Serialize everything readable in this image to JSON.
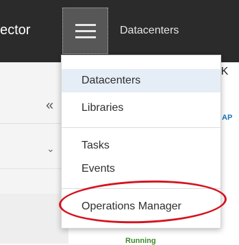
{
  "header": {
    "brand": "ector",
    "nav_label": "Datacenters"
  },
  "left_pane": {
    "collapse_glyph": "«",
    "expand_glyph": "⌄"
  },
  "background": {
    "title_fragment": ")-K",
    "link_fragment": "AP",
    "status": "Running"
  },
  "dropdown": {
    "items": [
      {
        "label": "Datacenters",
        "selected": true
      },
      {
        "label": "Libraries",
        "selected": false
      },
      {
        "label": "Tasks",
        "selected": false
      },
      {
        "label": "Events",
        "selected": false
      },
      {
        "label": "Operations Manager",
        "selected": false
      }
    ]
  },
  "annotation": {
    "color": "#d5131f",
    "target": "Operations Manager"
  },
  "colors": {
    "header_bg": "#2b2b2b",
    "selected_bg": "#e5eef6",
    "link": "#1a73b8",
    "status_green": "#3c8c2c"
  }
}
